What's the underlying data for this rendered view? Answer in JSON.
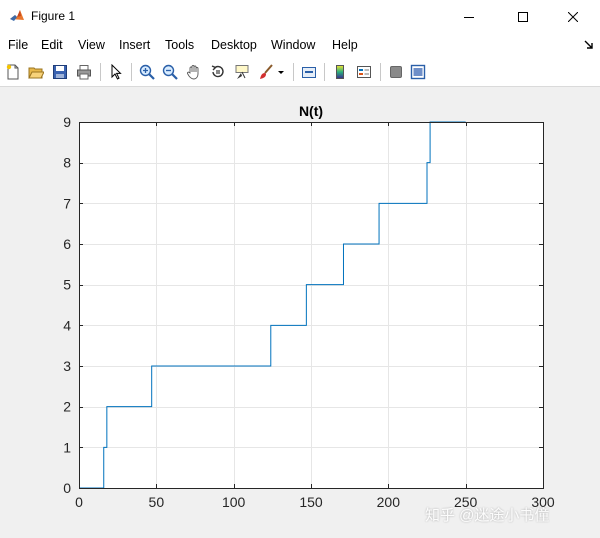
{
  "window": {
    "title": "Figure 1"
  },
  "menu": {
    "items": [
      "File",
      "Edit",
      "View",
      "Insert",
      "Tools",
      "Desktop",
      "Window",
      "Help"
    ]
  },
  "toolbar": {
    "icons": [
      "new-figure-icon",
      "open-file-icon",
      "save-icon",
      "print-icon",
      "edit-plot-arrow-icon",
      "zoom-in-icon",
      "zoom-out-icon",
      "pan-hand-icon",
      "rotate-3d-icon",
      "data-cursor-icon",
      "brush-icon",
      "brush-dropdown-icon",
      "link-plot-icon",
      "colorbar-icon",
      "legend-icon",
      "hide-plot-tools-icon",
      "show-plot-tools-icon"
    ]
  },
  "chart_data": {
    "type": "line",
    "title": "N(t)",
    "xlabel": "",
    "ylabel": "",
    "xlim": [
      0,
      300
    ],
    "ylim": [
      0,
      9
    ],
    "xticks": [
      0,
      50,
      100,
      150,
      200,
      250,
      300
    ],
    "yticks": [
      0,
      1,
      2,
      3,
      4,
      5,
      6,
      7,
      8,
      9
    ],
    "grid": true,
    "series": [
      {
        "color": "#0072bd",
        "step": true,
        "x": [
          0,
          16,
          18,
          47,
          124,
          147,
          171,
          194,
          225,
          227,
          250
        ],
        "y": [
          0,
          1,
          2,
          3,
          4,
          5,
          6,
          7,
          8,
          9,
          9
        ]
      }
    ]
  },
  "watermark": {
    "text": "知乎 @迷途小书僮"
  }
}
